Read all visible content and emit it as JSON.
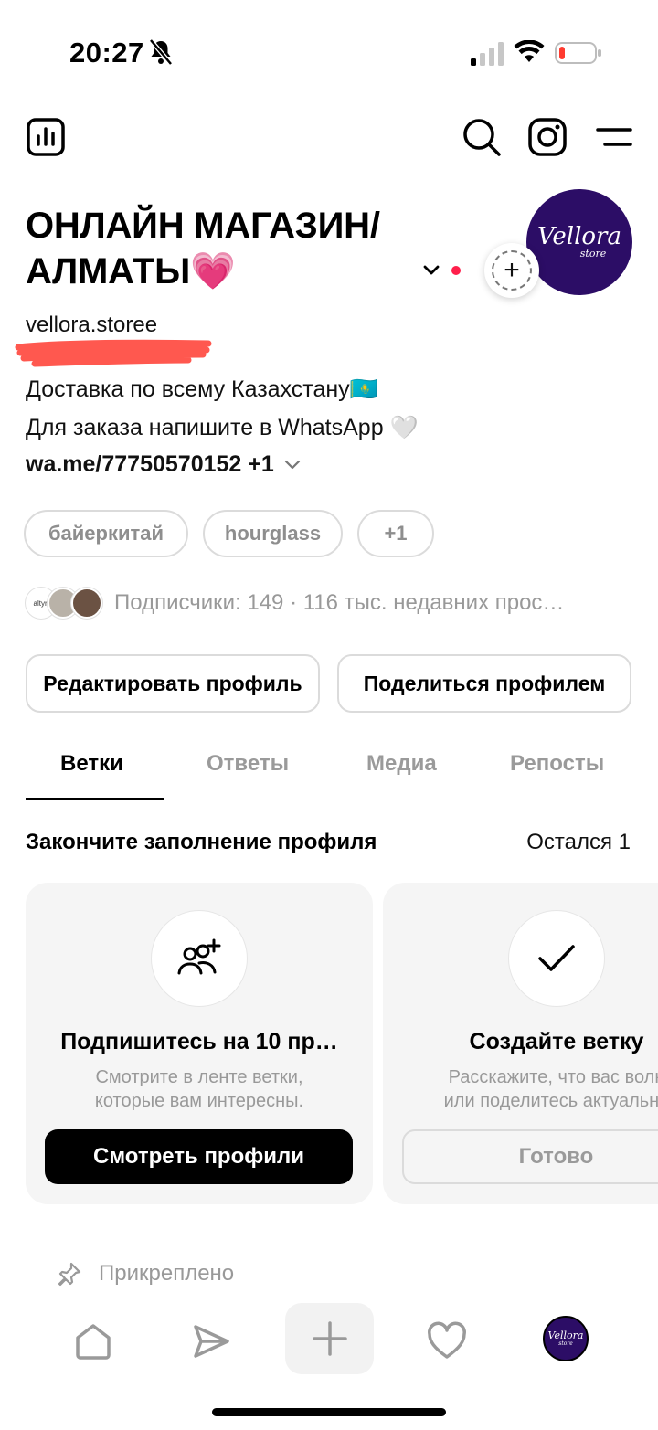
{
  "status_bar": {
    "time": "20:27"
  },
  "profile": {
    "name": "ОНЛАЙН МАГАЗИН/ АЛМАТЫ💗",
    "username": "vellora.storee",
    "avatar_brand": "Vellora",
    "avatar_sub": "store",
    "bio": [
      "Доставка по всему Казахстану🇰🇿",
      "Для заказа напишите в WhatsApp 🤍"
    ],
    "link": "wa.me/77750570152 +1",
    "tags": [
      "байеркитай",
      "hourglass",
      "+1"
    ],
    "followers_text": "Подписчики: 149 · 116 тыс. недавних прос…",
    "mini_avatar_text": "altyn"
  },
  "buttons": {
    "edit_profile": "Редактировать профиль",
    "share_profile": "Поделиться профилем"
  },
  "tabs": [
    "Ветки",
    "Ответы",
    "Медиа",
    "Репосты"
  ],
  "complete": {
    "title": "Закончите заполнение профиля",
    "count": "Остался 1",
    "cards": [
      {
        "title": "Подпишитесь на 10 пр…",
        "desc1": "Смотрите в ленте ветки,",
        "desc2": "которые вам интересны.",
        "button": "Смотреть профили"
      },
      {
        "title": "Создайте ветку",
        "desc1": "Расскажите, что вас волн",
        "desc2": "или поделитесь актуально",
        "button": "Готово"
      }
    ]
  },
  "pinned": "Прикреплено",
  "bottom_nav": {
    "avatar_brand": "Vellora",
    "avatar_sub": "store"
  }
}
